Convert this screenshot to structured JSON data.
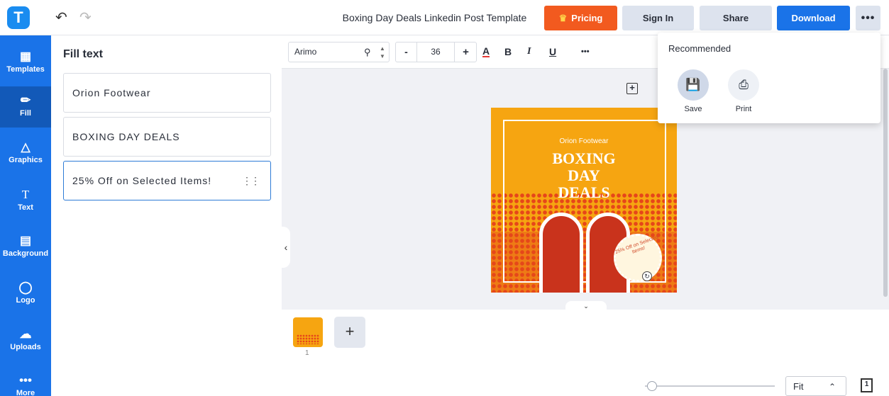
{
  "app": {
    "logo_letter": "T",
    "document_title": "Boxing Day Deals Linkedin Post Template"
  },
  "header": {
    "pricing_label": "Pricing",
    "signin_label": "Sign In",
    "share_label": "Share",
    "download_label": "Download",
    "more_label": "•••"
  },
  "sidebar": {
    "items": [
      {
        "label": "Templates",
        "icon": "templates-icon"
      },
      {
        "label": "Fill",
        "icon": "pencil-icon"
      },
      {
        "label": "Graphics",
        "icon": "shapes-icon"
      },
      {
        "label": "Text",
        "icon": "text-icon"
      },
      {
        "label": "Background",
        "icon": "background-icon"
      },
      {
        "label": "Logo",
        "icon": "logo-icon"
      },
      {
        "label": "Uploads",
        "icon": "cloud-upload-icon"
      },
      {
        "label": "More",
        "icon": "more-icon"
      }
    ]
  },
  "fill_panel": {
    "title": "Fill text",
    "fields": [
      "Orion Footwear",
      "BOXING DAY DEALS",
      "25% Off on Selected Items!"
    ]
  },
  "toolbar": {
    "font_family": "Arimo",
    "font_size": "36",
    "minus": "-",
    "plus": "+",
    "color_label": "A",
    "bold_label": "B",
    "italic_label": "I",
    "underline_label": "U",
    "more_label": "•••"
  },
  "design": {
    "brand": "Orion Footwear",
    "headline_1": "BOXING",
    "headline_2": "DAY",
    "headline_3": "DEALS",
    "badge": "25% Off on Selected Items!",
    "colors": {
      "background": "#f6a511",
      "dots": "#e6461a",
      "shoe": "#c9331c"
    }
  },
  "pages": {
    "page_number": "1",
    "add_label": "+"
  },
  "zoom": {
    "value": "Fit"
  },
  "dropdown": {
    "title": "Recommended",
    "items": [
      {
        "label": "Save",
        "icon": "save-icon"
      },
      {
        "label": "Print",
        "icon": "print-icon"
      }
    ]
  },
  "colors": {
    "accent": "#1a73e8",
    "pricing": "#f25a1f",
    "sidebar_active": "#1259b8"
  }
}
